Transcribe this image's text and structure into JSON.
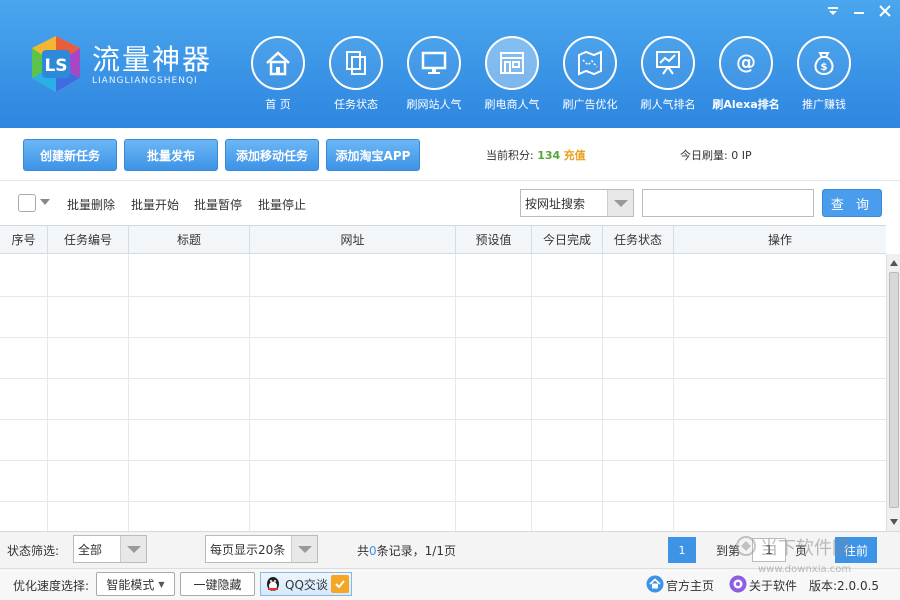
{
  "app": {
    "title_cn": "流量神器",
    "title_en": "LIANGLIANGSHENQI"
  },
  "nav": [
    {
      "label": "首  页",
      "icon": "home-icon"
    },
    {
      "label": "任务状态",
      "icon": "documents-icon"
    },
    {
      "label": "刷网站人气",
      "icon": "monitor-icon"
    },
    {
      "label": "刷电商人气",
      "icon": "storefront-icon"
    },
    {
      "label": "刷广告优化",
      "icon": "map-icon"
    },
    {
      "label": "刷人气排名",
      "icon": "presentation-chart-icon"
    },
    {
      "label": "刷Alexa排名",
      "icon": "at-sign-icon"
    },
    {
      "label": "推广赚钱",
      "icon": "money-bag-icon"
    }
  ],
  "toolbar": {
    "create_task": "创建新任务",
    "batch_publish": "批量发布",
    "add_mobile_task": "添加移动任务",
    "add_taobao_app": "添加淘宝APP",
    "points_label": "当前积分:",
    "points_value": "134",
    "recharge": "充值",
    "today_label": "今日刷量:",
    "today_value": "0 IP"
  },
  "filter": {
    "batch_delete": "批量删除",
    "batch_start": "批量开始",
    "batch_pause": "批量暂停",
    "batch_stop": "批量停止",
    "search_type": "按网址搜索",
    "search_value": "",
    "query_button": "查 询"
  },
  "table": {
    "columns": [
      "序号",
      "任务编号",
      "标题",
      "网址",
      "预设值",
      "今日完成",
      "任务状态",
      "操作"
    ],
    "rows": []
  },
  "pager": {
    "status_label": "状态筛选:",
    "status_value": "全部",
    "page_size": "每页显示20条",
    "records_prefix": "共",
    "records_count": "0",
    "records_suffix": "条记录，1/1页",
    "current_page": "1",
    "goto_prefix": "到第",
    "goto_value": "1",
    "goto_suffix": "页",
    "go_button": "往前"
  },
  "status": {
    "speed_label": "优化速度选择:",
    "speed_value": "智能模式",
    "hide_button": "一键隐藏",
    "qq_label": "QQ交谈",
    "home_link": "官方主页",
    "about_link": "关于软件",
    "version": "版本:2.0.0.5"
  },
  "watermark": {
    "text_cn": "当下软件园",
    "url": "www.downxia.com"
  },
  "colors": {
    "header": "#2e86e0",
    "accent": "#3d93e6",
    "points": "#57a639",
    "recharge": "#e8a020"
  }
}
